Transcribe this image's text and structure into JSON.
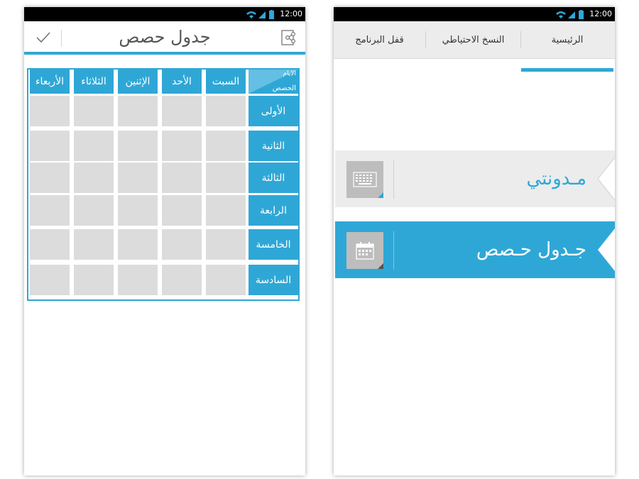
{
  "status_bar": {
    "time": "12:00"
  },
  "schedule_screen": {
    "title": "جدول حصص",
    "corner_top": "الايام",
    "corner_bottom": "الحصص",
    "days": [
      "السبت",
      "الأحد",
      "الإثنين",
      "الثلاثاء",
      "الأربعاء"
    ],
    "periods": [
      "الأولى",
      "الثانية",
      "الثالثة",
      "الرابعة",
      "الخامسة",
      "السادسة"
    ],
    "accent_color": "#2fa7d6",
    "cell_color": "#dcdcdc"
  },
  "home_screen": {
    "tabs": [
      "الرئيسية",
      "النسخ الاحتياطي",
      "قفل البرنامج"
    ],
    "active_tab": "الرئيسية",
    "menu": [
      {
        "label": "مـدونتي",
        "icon": "keyboard-icon"
      },
      {
        "label": "جـدول حـصص",
        "icon": "calendar-icon"
      }
    ],
    "accent_color": "#2fa7d6"
  }
}
